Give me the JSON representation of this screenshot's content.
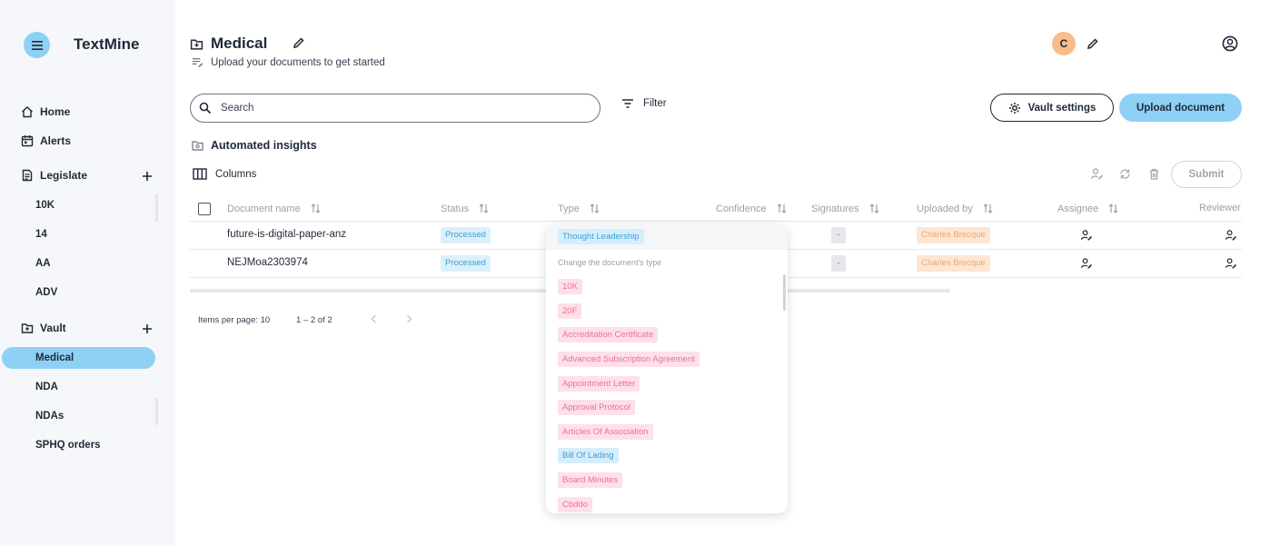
{
  "app": {
    "title": "TextMine"
  },
  "sidebar": {
    "home": "Home",
    "alerts": "Alerts",
    "legislate": {
      "label": "Legislate",
      "items": [
        "10K",
        "14",
        "AA",
        "ADV"
      ]
    },
    "vault": {
      "label": "Vault",
      "items": [
        "Medical",
        "NDA",
        "NDAs",
        "SPHQ orders"
      ],
      "active": "Medical"
    }
  },
  "header": {
    "title": "Medical",
    "subtitle": "Upload your documents to get started",
    "avatar_initial": "C"
  },
  "toolbar": {
    "search_placeholder": "Search",
    "filter_label": "Filter",
    "vault_settings_label": "Vault settings",
    "upload_label": "Upload document",
    "section_title": "Automated insights",
    "columns_label": "Columns",
    "submit_label": "Submit"
  },
  "table": {
    "columns": [
      "Document name",
      "Status",
      "Type",
      "Confidence",
      "Signatures",
      "Uploaded by",
      "Assignee",
      "Reviewer"
    ],
    "rows": [
      {
        "name": "future-is-digital-paper-anz",
        "status": "Processed",
        "signatures": "-",
        "uploaded_by": "Charles Brecque"
      },
      {
        "name": "NEJMoa2303974",
        "status": "Processed",
        "signatures": "-",
        "uploaded_by": "Charles Brecque"
      }
    ]
  },
  "pagination": {
    "items_per_page": "Items per page: 10",
    "range": "1 – 2 of 2"
  },
  "type_dropdown": {
    "selected": "Thought Leadership",
    "hint": "Change the document's type",
    "options": [
      {
        "label": "10K",
        "color": "#ef6f95"
      },
      {
        "label": "20F",
        "color": "#ef6f95"
      },
      {
        "label": "Accreditation Certificate",
        "color": "#ef6f95"
      },
      {
        "label": "Advanced Subscription Agreement",
        "color": "#ef6f95"
      },
      {
        "label": "Appointment Letter",
        "color": "#ef6f95"
      },
      {
        "label": "Approval Protocol",
        "color": "#ef6f95"
      },
      {
        "label": "Articles Of Association",
        "color": "#ef6f95"
      },
      {
        "label": "Bill Of Lading",
        "color": "#3b9ed6"
      },
      {
        "label": "Board Minutes",
        "color": "#ef6f95"
      },
      {
        "label": "Cbddo",
        "color": "#ef6f95"
      }
    ]
  },
  "colors": {
    "accent": "#8fd0f5",
    "avatar": "#f9bc8a",
    "chip_pink": "#ef6f95",
    "chip_blue": "#3b9ed6"
  }
}
